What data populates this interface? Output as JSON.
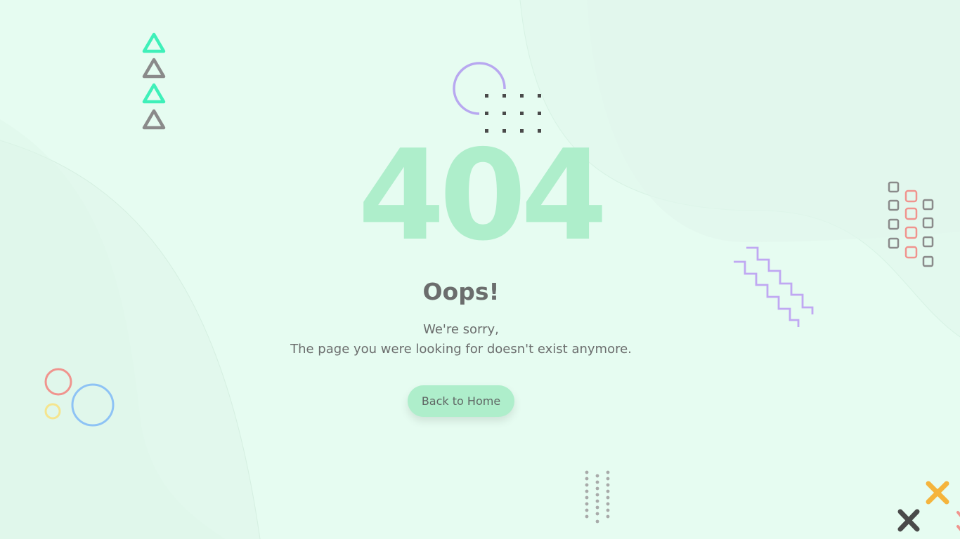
{
  "error": {
    "code": "404",
    "headline": "Oops!",
    "line1": "We're sorry,",
    "line2": "The page you were looking for doesn't exist anymore.",
    "button_label": "Back to Home"
  },
  "colors": {
    "background": "#e6fcf1",
    "code": "#aeeecb",
    "text": "#6b6d6d",
    "button": "#aeeecb",
    "teal": "#3ff0b9",
    "gray": "#8a8a8a",
    "purple": "#b8a8f0",
    "coral": "#f0948e",
    "blue": "#8ec3f5",
    "yellow": "#f5e58e",
    "orange": "#f5b43c",
    "dark": "#4a4a4a"
  },
  "decorations": {
    "triangles": [
      "teal-triangle-icon",
      "gray-triangle-icon",
      "teal-triangle-icon",
      "gray-triangle-icon"
    ],
    "circles": [
      "coral-circle-icon",
      "yellow-circle-icon",
      "blue-circle-icon"
    ],
    "squares": "square-grid-icon",
    "zigzags": "zigzag-lines-icon",
    "dots": "dot-grid-icon",
    "crosses": [
      "orange-cross-icon",
      "dark-cross-icon",
      "coral-cross-icon"
    ]
  }
}
